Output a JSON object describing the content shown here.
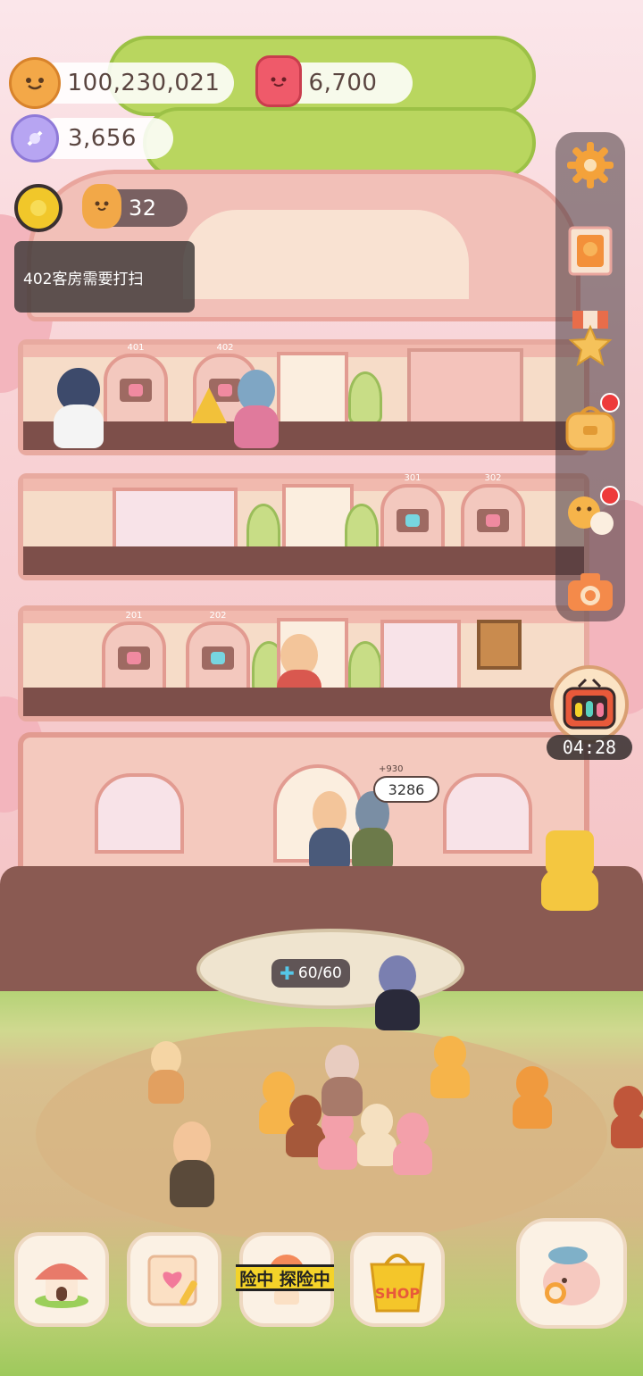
{
  "hud": {
    "cookies": "100,230,021",
    "gems": "6,700",
    "candy": "3,656",
    "staff_count": "32"
  },
  "notice": {
    "text": "402客房需要打扫"
  },
  "rooms": {
    "r401": "401",
    "r402": "402",
    "r301": "301",
    "r302": "302",
    "r201": "201",
    "r202": "202"
  },
  "guest_bubble": {
    "small": "+930",
    "value": "3286"
  },
  "tv_timer": "04:28",
  "energy": "60/60",
  "adventure_tape": "险中 探险中",
  "shop_label": "SHOP",
  "side_menu": [
    {
      "name": "settings",
      "icon": "gear-icon"
    },
    {
      "name": "stamp",
      "icon": "stamp-icon"
    },
    {
      "name": "medal",
      "icon": "medal-icon"
    },
    {
      "name": "bag",
      "icon": "bag-icon"
    },
    {
      "name": "friends",
      "icon": "friends-icon"
    },
    {
      "name": "camera",
      "icon": "camera-icon"
    }
  ],
  "colors": {
    "hud_bg": "#ffffff",
    "notice_bg": "#3c3737",
    "alert_red": "#ee3b3b",
    "tape_yellow": "#f4d329"
  }
}
